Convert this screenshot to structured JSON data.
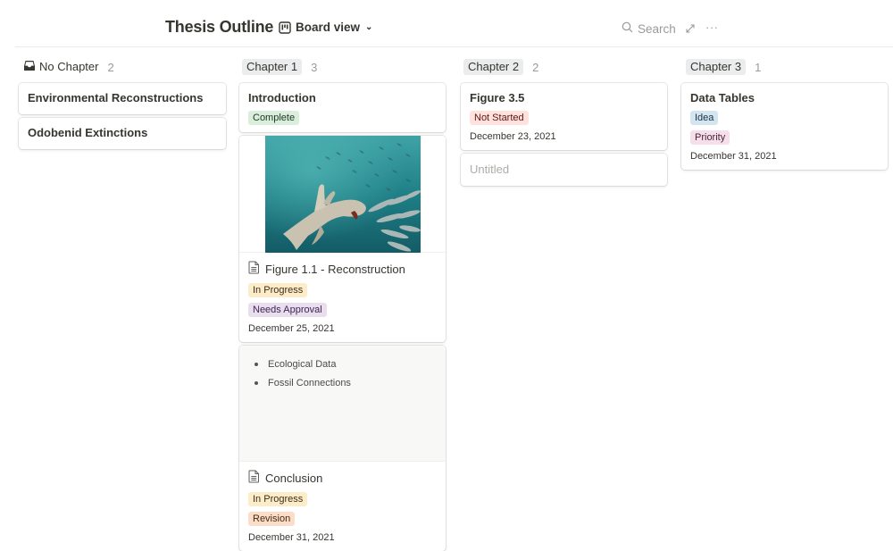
{
  "header": {
    "title": "Thesis Outline",
    "view_label": "Board view",
    "view_icon": "board-icon",
    "search_label": "Search",
    "expand_icon": "expand-icon",
    "more_icon": "more-icon",
    "more_glyph": "···"
  },
  "colors": {
    "tag_complete_bg": "#dbeddb",
    "tag_complete_fg": "#1c3829",
    "tag_in_progress_bg": "#fdecc8",
    "tag_in_progress_fg": "#402c1b",
    "tag_needs_approval_bg": "#e8deee",
    "tag_needs_approval_fg": "#412454",
    "tag_not_started_bg": "#ffe2dd",
    "tag_not_started_fg": "#5d1715",
    "tag_idea_bg": "#d3e5ef",
    "tag_idea_fg": "#183347",
    "tag_priority_bg": "#f5e0e9",
    "tag_priority_fg": "#4c2337",
    "tag_revision_bg": "#fadec9",
    "tag_revision_fg": "#49290e"
  },
  "columns": [
    {
      "label": "No Chapter",
      "count": "2",
      "icon": "inbox-icon",
      "cards": [
        {
          "title": "Environmental Reconstructions"
        },
        {
          "title": "Odobenid Extinctions"
        }
      ]
    },
    {
      "label": "Chapter 1",
      "count": "3",
      "cards": [
        {
          "title": "Introduction",
          "tags": [
            "Complete"
          ]
        },
        {
          "title": "Figure 1.1 - Reconstruction",
          "tags": [
            "In Progress",
            "Needs Approval"
          ],
          "date": "December 25, 2021",
          "image_alt": "Illustration of an extinct marine mammal hunting a school of fish underwater"
        },
        {
          "bullets": [
            "Ecological Data",
            "Fossil Connections"
          ],
          "title": "Conclusion",
          "tags": [
            "In Progress",
            "Revision"
          ],
          "date": "December 31, 2021"
        }
      ]
    },
    {
      "label": "Chapter 2",
      "count": "2",
      "cards": [
        {
          "title": "Figure 3.5",
          "tags": [
            "Not Started"
          ],
          "date": "December 23, 2021"
        },
        {
          "title": "Untitled"
        }
      ]
    },
    {
      "label": "Chapter 3",
      "count": "1",
      "cards": [
        {
          "title": "Data Tables",
          "tags": [
            "Idea",
            "Priority"
          ],
          "date": "December 31, 2021"
        }
      ]
    }
  ]
}
